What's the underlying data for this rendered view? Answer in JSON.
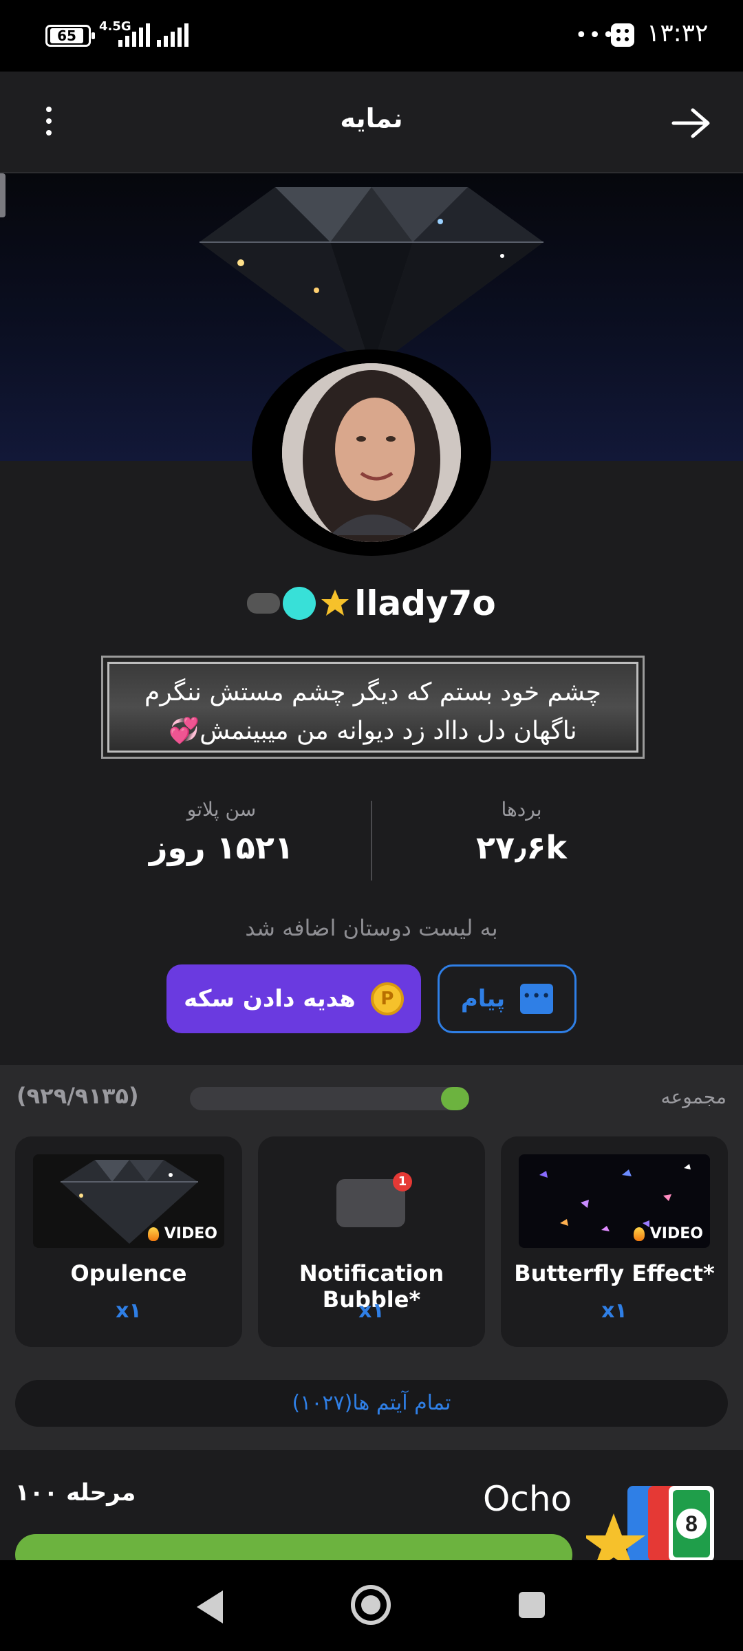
{
  "status_bar": {
    "battery": "65",
    "network": "4.5G",
    "dots": "•••",
    "time": "۱۳:۳۲"
  },
  "app_bar": {
    "title": "نمایه"
  },
  "profile": {
    "username": "llady7o",
    "bio_line1": "چشم خود بستم که دیگر چشم مستش ننگرم",
    "bio_line2": "ناگهان دل دااد زد دیوانه من میبینمش💞",
    "stats": {
      "wins_label": "بردها",
      "wins_value": "۲۷٫۶k",
      "age_label": "سن پلاتو",
      "age_value": "۱۵۲۱ روز"
    },
    "friend_note": "به لیست دوستان اضافه شد",
    "gift_button": "هدیه دادن سکه",
    "gift_coin_letter": "P",
    "message_button": "پیام"
  },
  "collection": {
    "title": "مجموعه",
    "count": "(۹۲۹/۹۱۳۵)",
    "progress_fraction": 0.102,
    "items": [
      {
        "name": "Butterfly Effect*",
        "qty": "x۱",
        "tag": "VIDEO"
      },
      {
        "name": "Notification Bubble*",
        "qty": "x۱",
        "badge": "1"
      },
      {
        "name": "Opulence",
        "qty": "x۱",
        "tag": "VIDEO"
      }
    ],
    "all_items": "تمام آیتم ها(۱۰۲۷)"
  },
  "game": {
    "level": "مرحله ۱۰۰",
    "name": "Ocho"
  },
  "colors": {
    "accent_purple": "#6a3ae0",
    "accent_blue": "#2f7fe6",
    "progress_green": "#6cb33f"
  }
}
